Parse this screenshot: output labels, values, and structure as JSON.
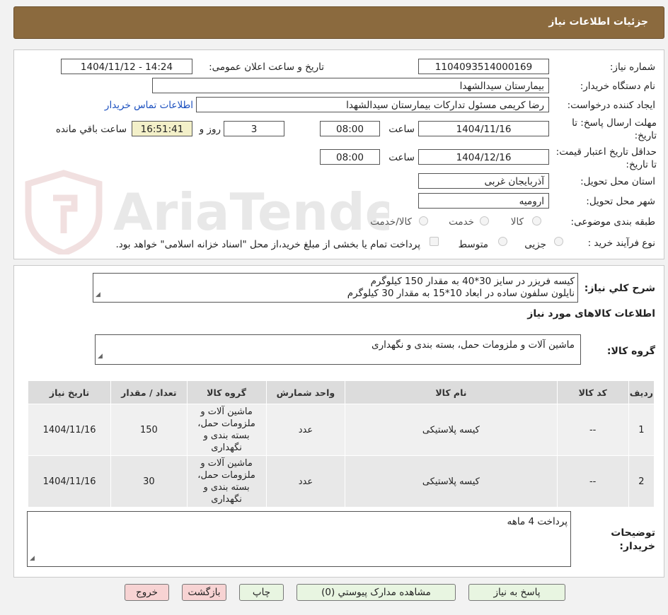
{
  "header": {
    "title": "جزئیات اطلاعات نیاز"
  },
  "form": {
    "need_number": {
      "label": "شماره نیاز:",
      "value": "1104093514000169"
    },
    "announce_datetime": {
      "label": "تاریخ و ساعت اعلان عمومی:",
      "value": "1404/11/12 - 14:24"
    },
    "buyer_org": {
      "label": "نام دستگاه خریدار:",
      "value": "بیمارستان سیدالشهدا"
    },
    "creator": {
      "label": "ایجاد کننده درخواست:",
      "value": "رضا کریمی مسئول تدارکات بیمارستان سیدالشهدا",
      "contact_link": "اطلاعات تماس خریدار"
    },
    "reply_deadline": {
      "label": "مهلت ارسال پاسخ: تا تاریخ:",
      "date": "1404/11/16",
      "time_label": "ساعت",
      "time": "08:00",
      "days": "3",
      "days_label": "روز و",
      "remaining": "16:51:41",
      "remaining_label": "ساعت باقي مانده"
    },
    "price_validity": {
      "label": "حداقل تاریخ اعتبار قیمت: تا تاریخ:",
      "date": "1404/12/16",
      "time_label": "ساعت",
      "time": "08:00"
    },
    "province": {
      "label": "استان محل تحویل:",
      "value": "آذربایجان غربی"
    },
    "city": {
      "label": "شهر محل تحویل:",
      "value": "ارومیه"
    },
    "category": {
      "label": "طبقه بندی موضوعی:",
      "options": [
        "کالا",
        "خدمت",
        "کالا/خدمت"
      ]
    },
    "process_type": {
      "label": "نوع فرآیند خرید :",
      "options": [
        "جزیی",
        "متوسط"
      ],
      "note": "پرداخت تمام یا بخشی از مبلغ خرید،از محل \"اسناد خزانه اسلامی\" خواهد بود."
    }
  },
  "summary": {
    "label": "شرح کلي نياز:",
    "lines": [
      "کیسه فریزر در سایز 30*40 به مقدار 150 کیلوگرم",
      "نایلون سلفون ساده در ابعاد 10*15 به مقدار 30 کیلوگرم"
    ]
  },
  "goods_section": {
    "title": "اطلاعات کالاهای مورد نیاز"
  },
  "goods_group": {
    "label": "گروه کالا:",
    "value": "ماشین آلات و ملزومات حمل، بسته بندی و نگهداری"
  },
  "table": {
    "headers": [
      "ردیف",
      "کد کالا",
      "نام کالا",
      "واحد شمارش",
      "گروه کالا",
      "تعداد / مقدار",
      "تاریخ نیاز"
    ],
    "rows": [
      [
        "1",
        "--",
        "کیسه پلاستیکی",
        "عدد",
        "ماشین آلات و ملزومات حمل، بسته بندی و نگهداری",
        "150",
        "1404/11/16"
      ],
      [
        "2",
        "--",
        "کیسه پلاستیکی",
        "عدد",
        "ماشین آلات و ملزومات حمل، بسته بندی و نگهداری",
        "30",
        "1404/11/16"
      ]
    ]
  },
  "buyer_notes": {
    "label": "توضیحات خریدار:",
    "value": "پرداخت 4 ماهه"
  },
  "buttons": {
    "reply": "پاسخ به نیاز",
    "attachments": "مشاهده مدارک پیوستي (0)",
    "print": "چاپ",
    "back": "بازگشت",
    "exit": "خروج"
  },
  "watermark": {
    "text": "AriaTender.net"
  }
}
